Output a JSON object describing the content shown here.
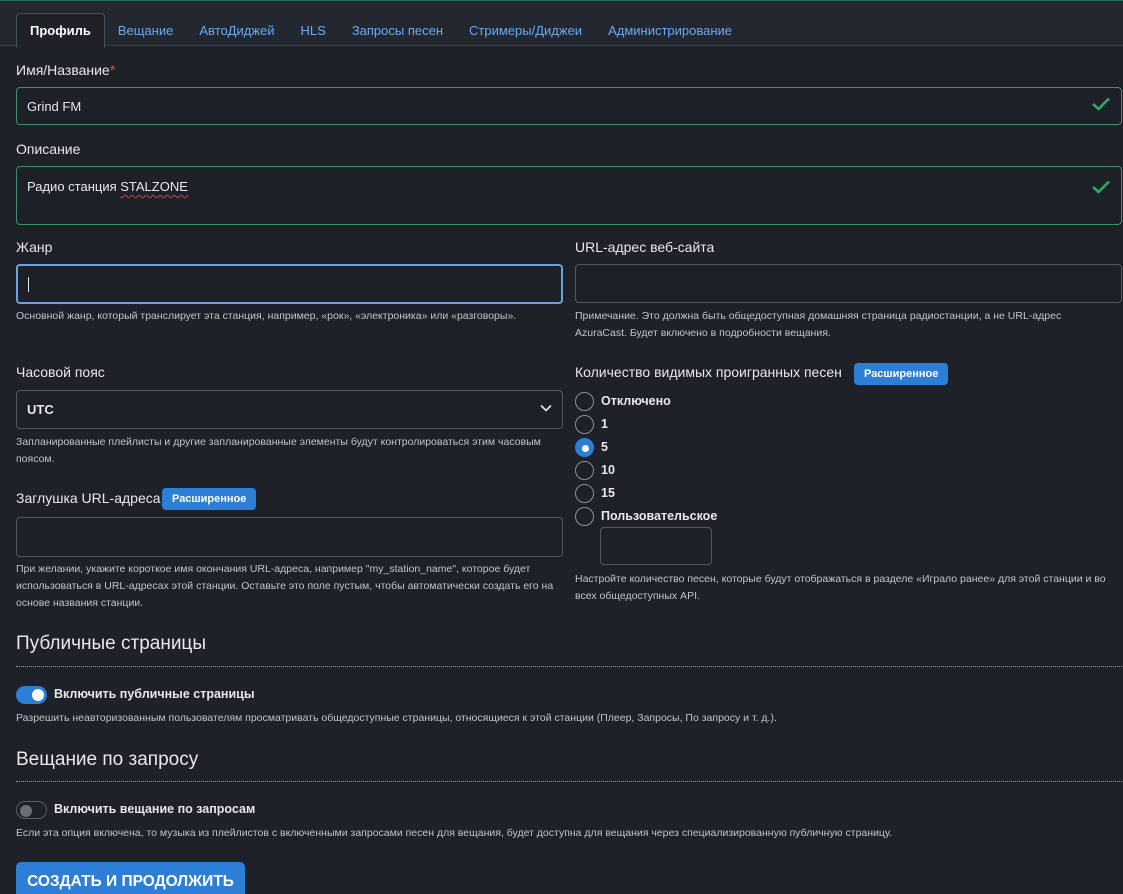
{
  "tabs": [
    "Профиль",
    "Вещание",
    "АвтоДиджей",
    "HLS",
    "Запросы песен",
    "Стримеры/Диджеи",
    "Администрирование"
  ],
  "name": {
    "label": "Имя/Название",
    "required_mark": "*",
    "value": "Grind FM"
  },
  "description": {
    "label": "Описание",
    "value_prefix": "Радио станция ",
    "value_flagged": "STALZONE"
  },
  "genre": {
    "label": "Жанр",
    "value": "",
    "help": "Основной жанр, который транслирует эта станция, например, «рок», «электроника» или «разговоры»."
  },
  "website": {
    "label": "URL-адрес веб-сайта",
    "value": "",
    "help": "Примечание. Это должна быть общедоступная домашняя страница радиостанции, а не URL-адрес AzuraCast. Будет включено в подробности вещания."
  },
  "timezone": {
    "label": "Часовой пояс",
    "selected": "UTC",
    "help": "Запланированные плейлисты и другие запланированные элементы будут контролироваться этим часовым поясом."
  },
  "history": {
    "label": "Количество видимых проигранных песен",
    "badge": "Расширенное",
    "options": [
      "Отключено",
      "1",
      "5",
      "10",
      "15",
      "Пользовательское"
    ],
    "selected_index": 2,
    "custom_value": "",
    "help": "Настройте количество песен, которые будут отображаться в разделе «Играло ранее» для этой станции и во всех общедоступных API."
  },
  "slug": {
    "label": "Заглушка URL-адреса",
    "badge": "Расширенное",
    "value": "",
    "help": "При желании, укажите короткое имя окончания URL-адреса, например \"my_station_name\", которое будет использоваться в URL-адресах этой станции. Оставьте это поле пустым, чтобы автоматически создать его на основе названия станции."
  },
  "public_pages": {
    "heading": "Публичные страницы",
    "toggle_label": "Включить публичные страницы",
    "enabled": true,
    "help": "Разрешить неавторизованным пользователям просматривать общедоступные страницы, относящиеся к этой станции (Плеер, Запросы, По запросу и т. д.)."
  },
  "on_demand": {
    "heading": "Вещание по запросу",
    "toggle_label": "Включить вещание по запросам",
    "enabled": false,
    "help": "Если эта опция включена, то музыка из плейлистов с включенными запросами песен для вещания, будет доступна для вещания через специализированную публичную страницу."
  },
  "submit_label": "СОЗДАТЬ И ПРОДОЛЖИТЬ",
  "colors": {
    "accent": "#2c7ed6",
    "valid": "#3f8f6a",
    "check": "#2fa86a",
    "link": "#6ea8f0"
  }
}
